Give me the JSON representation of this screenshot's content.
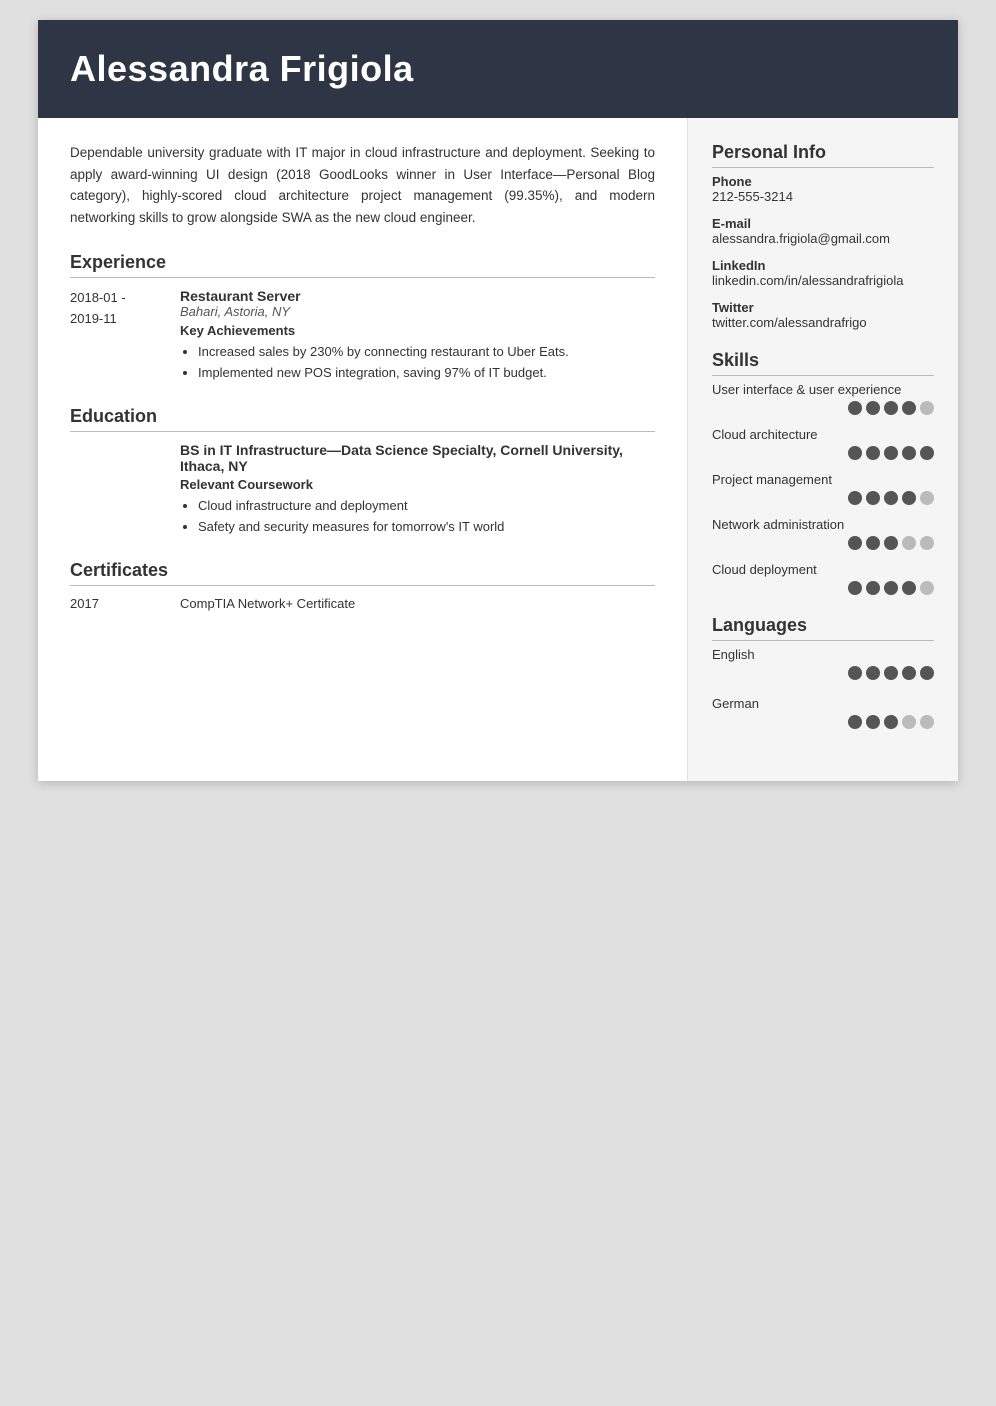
{
  "header": {
    "name": "Alessandra Frigiola"
  },
  "summary": "Dependable university graduate with IT major in cloud infrastructure and deployment. Seeking to apply award-winning UI design (2018 GoodLooks winner in User Interface—Personal Blog category), highly-scored cloud architecture project management (99.35%), and modern networking skills to grow alongside SWA as the new cloud engineer.",
  "sections": {
    "experience": {
      "title": "Experience",
      "entries": [
        {
          "date_start": "2018-01 -",
          "date_end": "2019-11",
          "title": "Restaurant Server",
          "company": "Bahari, Astoria, NY",
          "achievements_title": "Key Achievements",
          "bullets": [
            "Increased sales by 230% by connecting restaurant to Uber Eats.",
            "Implemented new POS integration, saving 97% of IT budget."
          ]
        }
      ]
    },
    "education": {
      "title": "Education",
      "entries": [
        {
          "degree": "BS in IT Infrastructure—Data Science Specialty, Cornell University, Ithaca, NY",
          "coursework_title": "Relevant Coursework",
          "bullets": [
            "Cloud infrastructure and deployment",
            "Safety and security measures for tomorrow's IT world"
          ]
        }
      ]
    },
    "certificates": {
      "title": "Certificates",
      "entries": [
        {
          "year": "2017",
          "name": "CompTIA Network+ Certificate"
        }
      ]
    }
  },
  "sidebar": {
    "personal_info": {
      "title": "Personal Info",
      "items": [
        {
          "label": "Phone",
          "value": "212-555-3214"
        },
        {
          "label": "E-mail",
          "value": "alessandra.frigiola@gmail.com"
        },
        {
          "label": "LinkedIn",
          "value": "linkedin.com/in/alessandrafrigiola"
        },
        {
          "label": "Twitter",
          "value": "twitter.com/alessandrafrigo"
        }
      ]
    },
    "skills": {
      "title": "Skills",
      "items": [
        {
          "name": "User interface & user experience",
          "filled": 4,
          "total": 5
        },
        {
          "name": "Cloud architecture",
          "filled": 5,
          "total": 5
        },
        {
          "name": "Project management",
          "filled": 4,
          "total": 5
        },
        {
          "name": "Network administration",
          "filled": 3,
          "total": 5
        },
        {
          "name": "Cloud deployment",
          "filled": 4,
          "total": 5
        }
      ]
    },
    "languages": {
      "title": "Languages",
      "items": [
        {
          "name": "English",
          "filled": 5,
          "total": 5
        },
        {
          "name": "German",
          "filled": 3,
          "total": 5
        }
      ]
    }
  }
}
